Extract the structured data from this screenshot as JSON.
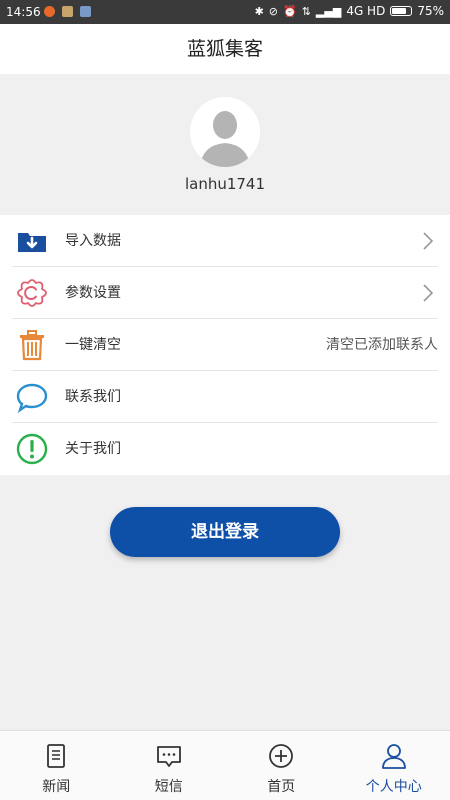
{
  "status_bar": {
    "time": "14:56",
    "network": "4G HD",
    "battery": "75%"
  },
  "header": {
    "title": "蓝狐集客"
  },
  "profile": {
    "username": "lanhu1741"
  },
  "menu": {
    "items": [
      {
        "label": "导入数据",
        "icon": "import-folder-icon",
        "color": "#1a4fa0",
        "right_text": "",
        "chevron": true
      },
      {
        "label": "参数设置",
        "icon": "settings-gear-icon",
        "color": "#e06070",
        "right_text": "",
        "chevron": true
      },
      {
        "label": "一键清空",
        "icon": "trash-icon",
        "color": "#e8893a",
        "right_text": "清空已添加联系人",
        "chevron": false
      },
      {
        "label": "联系我们",
        "icon": "chat-bubble-icon",
        "color": "#2a8fd0",
        "right_text": "",
        "chevron": false
      },
      {
        "label": "关于我们",
        "icon": "info-exclamation-icon",
        "color": "#2ab04a",
        "right_text": "",
        "chevron": false
      }
    ]
  },
  "logout": {
    "label": "退出登录",
    "color": "#0e4fa8"
  },
  "tabs": [
    {
      "label": "新闻",
      "icon": "news-document-icon",
      "active": false
    },
    {
      "label": "短信",
      "icon": "sms-message-icon",
      "active": false
    },
    {
      "label": "首页",
      "icon": "home-plus-icon",
      "active": false
    },
    {
      "label": "个人中心",
      "icon": "user-profile-icon",
      "active": true
    }
  ]
}
